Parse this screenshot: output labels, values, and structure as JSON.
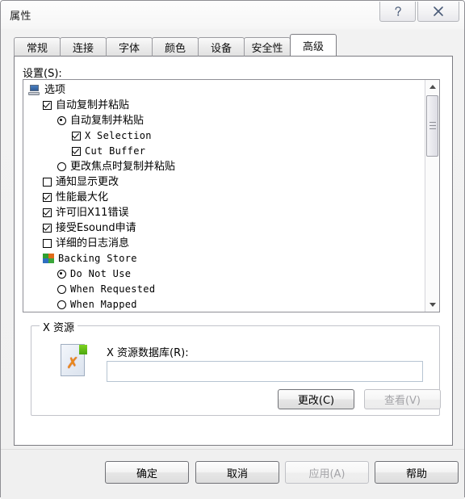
{
  "window": {
    "title": "属性",
    "caption_buttons": [
      {
        "name": "help-button",
        "glyph": "?"
      },
      {
        "name": "close-button",
        "glyph": "✕"
      }
    ]
  },
  "tabs": [
    {
      "label": "常规",
      "selected": false
    },
    {
      "label": "连接",
      "selected": false
    },
    {
      "label": "字体",
      "selected": false
    },
    {
      "label": "颜色",
      "selected": false
    },
    {
      "label": "设备",
      "selected": false
    },
    {
      "label": "安全性",
      "selected": false
    },
    {
      "label": "高级",
      "selected": true
    }
  ],
  "settings": {
    "label": "设置(S):",
    "tree": [
      {
        "indent": 0,
        "control": "icon-computer",
        "label": "选项",
        "style": "cjk"
      },
      {
        "indent": 1,
        "control": "checkbox-checked",
        "label": "自动复制并粘贴",
        "style": "cjk"
      },
      {
        "indent": 2,
        "control": "radio-checked",
        "label": "自动复制并粘贴",
        "style": "cjk"
      },
      {
        "indent": 3,
        "control": "checkbox-checked",
        "label": "X Selection",
        "style": "mono"
      },
      {
        "indent": 3,
        "control": "checkbox-checked",
        "label": "Cut Buffer",
        "style": "mono"
      },
      {
        "indent": 2,
        "control": "radio-unchecked",
        "label": "更改焦点时复制并粘贴",
        "style": "cjk"
      },
      {
        "indent": 1,
        "control": "checkbox-unchecked",
        "label": "通知显示更改",
        "style": "cjk"
      },
      {
        "indent": 1,
        "control": "checkbox-checked",
        "label": "性能最大化",
        "style": "cjk"
      },
      {
        "indent": 1,
        "control": "checkbox-checked",
        "label": "许可旧X11错误",
        "style": "cjk"
      },
      {
        "indent": 1,
        "control": "checkbox-checked",
        "label": "接受Esound申请",
        "style": "cjk"
      },
      {
        "indent": 1,
        "control": "checkbox-unchecked",
        "label": "详细的日志消息",
        "style": "cjk"
      },
      {
        "indent": 1,
        "control": "icon-blocks",
        "label": "Backing Store",
        "style": "mono"
      },
      {
        "indent": 2,
        "control": "radio-checked",
        "label": "Do Not Use",
        "style": "mono"
      },
      {
        "indent": 2,
        "control": "radio-unchecked",
        "label": "When Requested",
        "style": "mono"
      },
      {
        "indent": 2,
        "control": "radio-unchecked",
        "label": "When Mapped",
        "style": "mono"
      }
    ],
    "scrollbar": {
      "position": "near-top"
    }
  },
  "resources": {
    "group_title": "X 资源",
    "database_label": "X 资源数据库(R):",
    "database_value": "",
    "database_placeholder": "",
    "change_button": "更改(C)",
    "view_button": "查看(V)",
    "view_button_enabled": false
  },
  "footer": {
    "ok": "确定",
    "cancel": "取消",
    "apply": "应用(A)",
    "apply_enabled": false,
    "help": "帮助"
  },
  "colors": {
    "dialog_bg": "#f0f0f0",
    "page_bg": "#ffffff",
    "border": "#7c7c82",
    "caption_glyph": "#4a5b78"
  }
}
